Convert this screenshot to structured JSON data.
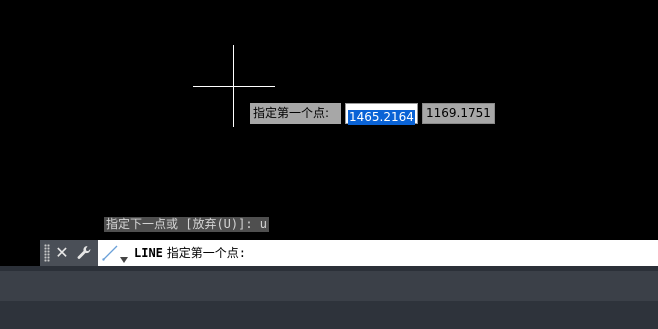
{
  "dynamic_input": {
    "label": "指定第一个点:",
    "x_value": "1465.2164",
    "y_value": "1169.1751"
  },
  "command_history": {
    "last_line": "指定下一点或 [放弃(U)]: u"
  },
  "command_line": {
    "command_name": "LINE",
    "prompt": "指定第一个点:"
  },
  "icons": {
    "grip": "grip-icon",
    "close": "close-icon",
    "customize": "wrench-icon",
    "command": "line-command-icon",
    "recent": "dropdown-arrow-icon"
  },
  "colors": {
    "canvas": "#000000",
    "selection": "#0a63d6",
    "tooltip": "#a7a7a7",
    "statusbar": "#3b4048"
  }
}
